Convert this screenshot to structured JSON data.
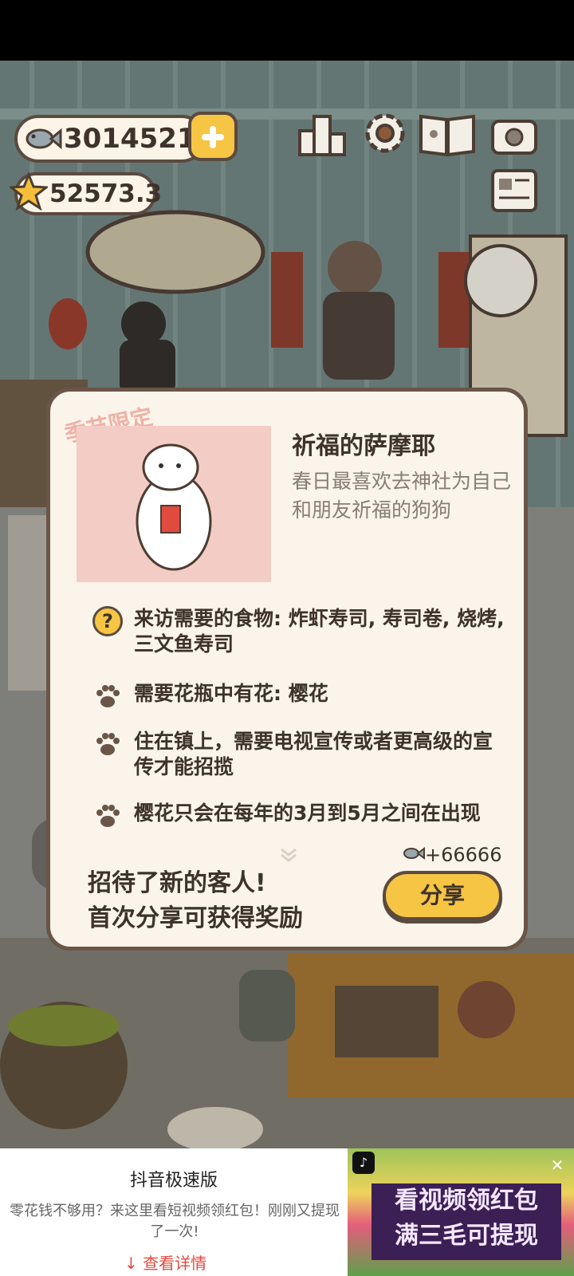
{
  "currency": {
    "fish": "3014521",
    "stars": "52573.3"
  },
  "top_icons": [
    "ranking-icon",
    "settings-gear-icon",
    "paw-book-icon",
    "camera-icon",
    "newspaper-icon"
  ],
  "dialog": {
    "season_tag": "季节限定",
    "character_name": "祈福的萨摩耶",
    "description": "春日最喜欢去神社为自己和朋友祈福的狗狗",
    "requirements": [
      {
        "icon": "question-icon",
        "text": "来访需要的食物: 炸虾寿司, 寿司卷, 烧烤, 三文鱼寿司"
      },
      {
        "icon": "paw-icon",
        "text": "需要花瓶中有花: 樱花"
      },
      {
        "icon": "paw-icon",
        "text": "住在镇上，需要电视宣传或者更高级的宣传才能招揽"
      },
      {
        "icon": "paw-icon",
        "text": "樱花只会在每年的3月到5月之间在出现"
      }
    ],
    "reward": "+66666",
    "message_line1": "招待了新的客人!",
    "message_line2": "首次分享可获得奖励",
    "share_label": "分享"
  },
  "ad": {
    "title": "抖音极速版",
    "text": "零花钱不够用？来这里看短视频领红包！刚刚又提现了一次!",
    "link": "查看详情",
    "banner_line1": "看视频领红包",
    "banner_line2": "满三毛可提现",
    "close": "✕"
  },
  "colors": {
    "accent": "#f7c544",
    "outline": "#5b4a3f",
    "dialog_bg": "#fbf4ea",
    "portrait_bg": "#f3cdc5"
  }
}
